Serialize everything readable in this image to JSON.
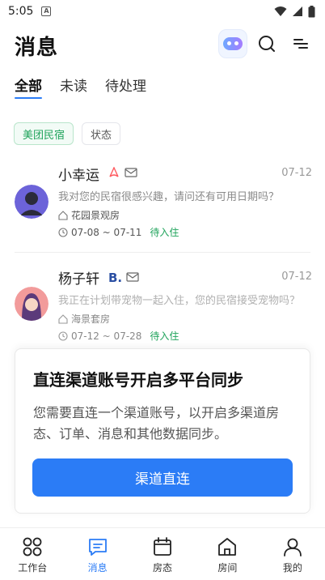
{
  "status_bar": {
    "time": "5:05",
    "notif_letter": "A"
  },
  "header": {
    "title": "消息"
  },
  "tabs": [
    {
      "label": "全部",
      "active": true
    },
    {
      "label": "未读",
      "active": false
    },
    {
      "label": "待处理",
      "active": false
    }
  ],
  "filters": [
    {
      "label": "美团民宿",
      "active": true
    },
    {
      "label": "状态",
      "active": false
    }
  ],
  "messages": [
    {
      "name": "小幸运",
      "date": "07-12",
      "text": "我对您的民宿很感兴趣，请问还有可用日期吗？",
      "room": "花园景观房",
      "dates": "07-08 ~ 07-11",
      "status": "待入住",
      "channel_icon": "airbnb-icon"
    },
    {
      "name": "杨子轩",
      "date": "07-12",
      "text": "我正在计划带宠物一起入住，您的民宿接受宠物吗？",
      "room": "海景套房",
      "dates": "07-12 ~ 07-28",
      "status": "待入住",
      "channel_icon": "booking-icon"
    }
  ],
  "card": {
    "title": "直连渠道账号开启多平台同步",
    "description": "您需要直连一个渠道账号，以开启多渠道房态、订单、消息和其他数据同步。",
    "button": "渠道直连"
  },
  "bottom_nav": [
    {
      "label": "工作台",
      "icon": "grid-icon",
      "active": false
    },
    {
      "label": "消息",
      "icon": "message-icon",
      "active": true
    },
    {
      "label": "房态",
      "icon": "calendar-icon",
      "active": false
    },
    {
      "label": "房间",
      "icon": "home-icon",
      "active": false
    },
    {
      "label": "我的",
      "icon": "user-icon",
      "active": false
    }
  ],
  "colors": {
    "accent": "#2b7cf6",
    "green": "#1fa35b",
    "airbnb": "#ff5a5f",
    "booking": "#2b4fa3"
  }
}
